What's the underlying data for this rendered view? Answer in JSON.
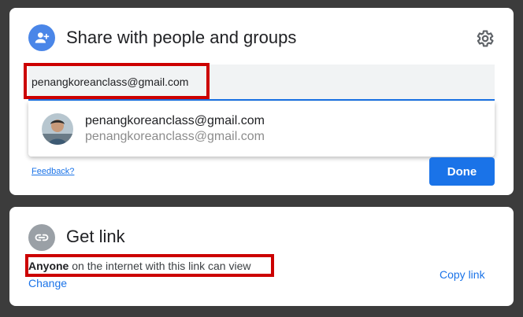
{
  "share": {
    "title": "Share with people and groups",
    "input_value": "penangkoreanclass@gmail.com",
    "suggestion": {
      "name": "penangkoreanclass@gmail.com",
      "email": "penangkoreanclass@gmail.com"
    },
    "feedback_label": "Feedback?",
    "done_label": "Done"
  },
  "link": {
    "title": "Get link",
    "access_bold": "Anyone",
    "access_rest": " on the internet with this link can view",
    "change_label": "Change",
    "copy_label": "Copy link"
  },
  "colors": {
    "accent": "#1a73e8",
    "highlight": "#cc0000",
    "share_icon_bg": "#4a86e8",
    "link_icon_bg": "#9aa0a6"
  },
  "icons": [
    "person-add-icon",
    "gear-icon",
    "link-icon"
  ]
}
